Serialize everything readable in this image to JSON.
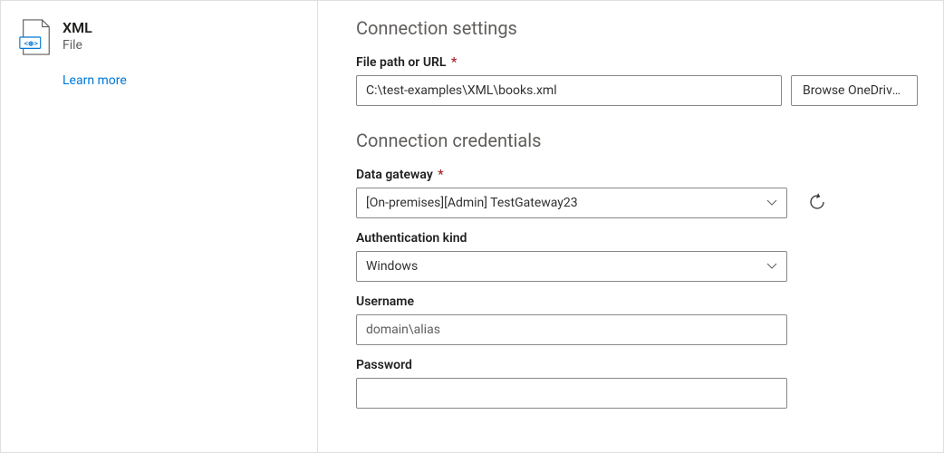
{
  "sidebar": {
    "title": "XML",
    "subtitle": "File",
    "learn_more": "Learn more"
  },
  "settings": {
    "heading": "Connection settings",
    "file_path": {
      "label": "File path or URL",
      "required": "*",
      "value": "C:\\test-examples\\XML\\books.xml",
      "browse_label": "Browse OneDrive..."
    }
  },
  "credentials": {
    "heading": "Connection credentials",
    "data_gateway": {
      "label": "Data gateway",
      "required": "*",
      "value": "[On-premises][Admin] TestGateway23"
    },
    "auth_kind": {
      "label": "Authentication kind",
      "value": "Windows"
    },
    "username": {
      "label": "Username",
      "placeholder": "domain\\alias",
      "value": ""
    },
    "password": {
      "label": "Password",
      "value": ""
    }
  }
}
